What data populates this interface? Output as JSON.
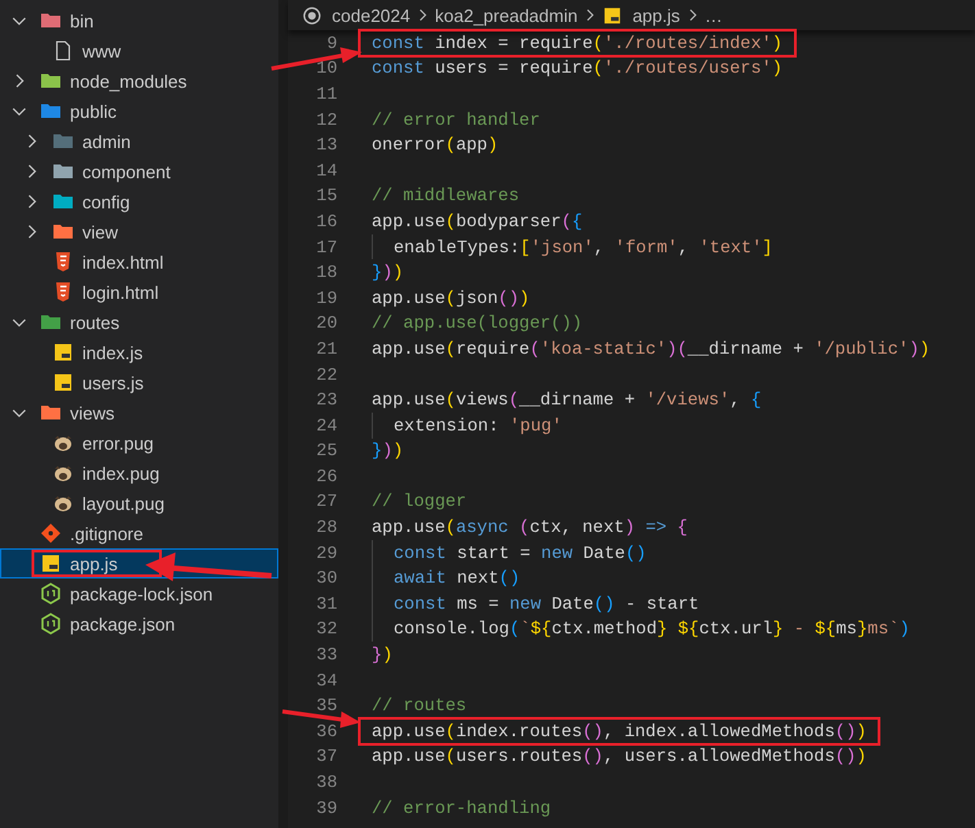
{
  "explorer": {
    "items": [
      {
        "label": "bin",
        "kind": "folder",
        "color": "#e06c75",
        "expanded": true,
        "selected": false,
        "highlighted": false,
        "children": [
          {
            "label": "www",
            "kind": "file",
            "selected": false,
            "highlighted": false
          }
        ]
      },
      {
        "label": "node_modules",
        "kind": "folder",
        "color": "#8bc34a",
        "expanded": false,
        "selected": false,
        "highlighted": false
      },
      {
        "label": "public",
        "kind": "folder",
        "color": "#1e88e5",
        "expanded": true,
        "selected": false,
        "highlighted": false,
        "children": [
          {
            "label": "admin",
            "kind": "folder",
            "color": "#546e7a",
            "expanded": false,
            "selected": false,
            "highlighted": false
          },
          {
            "label": "component",
            "kind": "folder",
            "color": "#90a4ae",
            "expanded": false,
            "selected": false,
            "highlighted": false
          },
          {
            "label": "config",
            "kind": "folder",
            "color": "#00acc1",
            "expanded": false,
            "selected": false,
            "highlighted": false
          },
          {
            "label": "view",
            "kind": "folder",
            "color": "#ff7043",
            "expanded": false,
            "selected": false,
            "highlighted": false
          },
          {
            "label": "index.html",
            "kind": "html",
            "selected": false,
            "highlighted": false
          },
          {
            "label": "login.html",
            "kind": "html",
            "selected": false,
            "highlighted": false
          }
        ]
      },
      {
        "label": "routes",
        "kind": "folder",
        "color": "#43a047",
        "expanded": true,
        "selected": false,
        "highlighted": false,
        "children": [
          {
            "label": "index.js",
            "kind": "js",
            "selected": false,
            "highlighted": false
          },
          {
            "label": "users.js",
            "kind": "js",
            "selected": false,
            "highlighted": false
          }
        ]
      },
      {
        "label": "views",
        "kind": "folder",
        "color": "#ff7043",
        "expanded": true,
        "selected": false,
        "highlighted": false,
        "children": [
          {
            "label": "error.pug",
            "kind": "pug",
            "selected": false,
            "highlighted": false
          },
          {
            "label": "index.pug",
            "kind": "pug",
            "selected": false,
            "highlighted": false
          },
          {
            "label": "layout.pug",
            "kind": "pug",
            "selected": false,
            "highlighted": false
          }
        ]
      },
      {
        "label": ".gitignore",
        "kind": "git",
        "selected": false,
        "highlighted": false
      },
      {
        "label": "app.js",
        "kind": "js",
        "selected": true,
        "highlighted": true
      },
      {
        "label": "package-lock.json",
        "kind": "node",
        "selected": false,
        "highlighted": false
      },
      {
        "label": "package.json",
        "kind": "node",
        "selected": false,
        "highlighted": false
      }
    ]
  },
  "breadcrumb": [
    {
      "label": "code2024",
      "kind": "root"
    },
    {
      "label": "koa2_preadadmin",
      "kind": "folder"
    },
    {
      "label": "app.js",
      "kind": "js"
    },
    {
      "label": "…",
      "kind": "more"
    }
  ],
  "editor": {
    "lines": [
      {
        "number": "9",
        "indented": false,
        "highlighted": true,
        "tokens": [
          {
            "text": "const ",
            "kind": "kw"
          },
          {
            "text": "index = require",
            "kind": "plain"
          },
          {
            "text": "(",
            "kind": "b1"
          },
          {
            "text": "'./routes/index'",
            "kind": "str"
          },
          {
            "text": ")",
            "kind": "b1"
          }
        ]
      },
      {
        "number": "10",
        "indented": false,
        "highlighted": false,
        "tokens": [
          {
            "text": "const ",
            "kind": "kw"
          },
          {
            "text": "users = require",
            "kind": "plain"
          },
          {
            "text": "(",
            "kind": "b1"
          },
          {
            "text": "'./routes/users'",
            "kind": "str"
          },
          {
            "text": ")",
            "kind": "b1"
          }
        ]
      },
      {
        "number": "11",
        "indented": false,
        "highlighted": false
      },
      {
        "number": "12",
        "indented": false,
        "highlighted": false,
        "tokens": [
          {
            "text": "// error handler",
            "kind": "com"
          }
        ]
      },
      {
        "number": "13",
        "indented": false,
        "highlighted": false,
        "tokens": [
          {
            "text": "onerror",
            "kind": "plain"
          },
          {
            "text": "(",
            "kind": "b1"
          },
          {
            "text": "app",
            "kind": "plain"
          },
          {
            "text": ")",
            "kind": "b1"
          }
        ]
      },
      {
        "number": "14",
        "indented": false,
        "highlighted": false
      },
      {
        "number": "15",
        "indented": false,
        "highlighted": false,
        "tokens": [
          {
            "text": "// middlewares",
            "kind": "com"
          }
        ]
      },
      {
        "number": "16",
        "indented": false,
        "highlighted": false,
        "tokens": [
          {
            "text": "app.use",
            "kind": "plain"
          },
          {
            "text": "(",
            "kind": "b1"
          },
          {
            "text": "bodyparser",
            "kind": "plain"
          },
          {
            "text": "(",
            "kind": "b2"
          },
          {
            "text": "{",
            "kind": "b3"
          }
        ]
      },
      {
        "number": "17",
        "indented": true,
        "highlighted": false,
        "tokens": [
          {
            "text": "enableTypes:",
            "kind": "plain"
          },
          {
            "text": "[",
            "kind": "b1"
          },
          {
            "text": "'json'",
            "kind": "str"
          },
          {
            "text": ", ",
            "kind": "plain"
          },
          {
            "text": "'form'",
            "kind": "str"
          },
          {
            "text": ", ",
            "kind": "plain"
          },
          {
            "text": "'text'",
            "kind": "str"
          },
          {
            "text": "]",
            "kind": "b1"
          }
        ]
      },
      {
        "number": "18",
        "indented": false,
        "highlighted": false,
        "tokens": [
          {
            "text": "}",
            "kind": "b3"
          },
          {
            "text": ")",
            "kind": "b2"
          },
          {
            "text": ")",
            "kind": "b1"
          }
        ]
      },
      {
        "number": "19",
        "indented": false,
        "highlighted": false,
        "tokens": [
          {
            "text": "app.use",
            "kind": "plain"
          },
          {
            "text": "(",
            "kind": "b1"
          },
          {
            "text": "json",
            "kind": "plain"
          },
          {
            "text": "()",
            "kind": "b2"
          },
          {
            "text": ")",
            "kind": "b1"
          }
        ]
      },
      {
        "number": "20",
        "indented": false,
        "highlighted": false,
        "tokens": [
          {
            "text": "// app.use(logger())",
            "kind": "com"
          }
        ]
      },
      {
        "number": "21",
        "indented": false,
        "highlighted": false,
        "tokens": [
          {
            "text": "app.use",
            "kind": "plain"
          },
          {
            "text": "(",
            "kind": "b1"
          },
          {
            "text": "require",
            "kind": "plain"
          },
          {
            "text": "(",
            "kind": "b2"
          },
          {
            "text": "'koa-static'",
            "kind": "str"
          },
          {
            "text": ")(",
            "kind": "b2"
          },
          {
            "text": "__dirname + ",
            "kind": "plain"
          },
          {
            "text": "'/public'",
            "kind": "str"
          },
          {
            "text": ")",
            "kind": "b2"
          },
          {
            "text": ")",
            "kind": "b1"
          }
        ]
      },
      {
        "number": "22",
        "indented": false,
        "highlighted": false
      },
      {
        "number": "23",
        "indented": false,
        "highlighted": false,
        "tokens": [
          {
            "text": "app.use",
            "kind": "plain"
          },
          {
            "text": "(",
            "kind": "b1"
          },
          {
            "text": "views",
            "kind": "plain"
          },
          {
            "text": "(",
            "kind": "b2"
          },
          {
            "text": "__dirname + ",
            "kind": "plain"
          },
          {
            "text": "'/views'",
            "kind": "str"
          },
          {
            "text": ", ",
            "kind": "plain"
          },
          {
            "text": "{",
            "kind": "b3"
          }
        ]
      },
      {
        "number": "24",
        "indented": true,
        "highlighted": false,
        "tokens": [
          {
            "text": "extension: ",
            "kind": "plain"
          },
          {
            "text": "'pug'",
            "kind": "str"
          }
        ]
      },
      {
        "number": "25",
        "indented": false,
        "highlighted": false,
        "tokens": [
          {
            "text": "}",
            "kind": "b3"
          },
          {
            "text": ")",
            "kind": "b2"
          },
          {
            "text": ")",
            "kind": "b1"
          }
        ]
      },
      {
        "number": "26",
        "indented": false,
        "highlighted": false
      },
      {
        "number": "27",
        "indented": false,
        "highlighted": false,
        "tokens": [
          {
            "text": "// logger",
            "kind": "com"
          }
        ]
      },
      {
        "number": "28",
        "indented": false,
        "highlighted": false,
        "tokens": [
          {
            "text": "app.use",
            "kind": "plain"
          },
          {
            "text": "(",
            "kind": "b1"
          },
          {
            "text": "async ",
            "kind": "kw"
          },
          {
            "text": "(",
            "kind": "b2"
          },
          {
            "text": "ctx, next",
            "kind": "plain"
          },
          {
            "text": ")",
            "kind": "b2"
          },
          {
            "text": " => ",
            "kind": "kw"
          },
          {
            "text": "{",
            "kind": "b2"
          }
        ]
      },
      {
        "number": "29",
        "indented": true,
        "highlighted": false,
        "tokens": [
          {
            "text": "const ",
            "kind": "kw"
          },
          {
            "text": "start = ",
            "kind": "plain"
          },
          {
            "text": "new ",
            "kind": "kw"
          },
          {
            "text": "Date",
            "kind": "plain"
          },
          {
            "text": "()",
            "kind": "b3"
          }
        ]
      },
      {
        "number": "30",
        "indented": true,
        "highlighted": false,
        "tokens": [
          {
            "text": "await ",
            "kind": "kw"
          },
          {
            "text": "next",
            "kind": "plain"
          },
          {
            "text": "()",
            "kind": "b3"
          }
        ]
      },
      {
        "number": "31",
        "indented": true,
        "highlighted": false,
        "tokens": [
          {
            "text": "const ",
            "kind": "kw"
          },
          {
            "text": "ms = ",
            "kind": "plain"
          },
          {
            "text": "new ",
            "kind": "kw"
          },
          {
            "text": "Date",
            "kind": "plain"
          },
          {
            "text": "()",
            "kind": "b3"
          },
          {
            "text": " - start",
            "kind": "plain"
          }
        ]
      },
      {
        "number": "32",
        "indented": true,
        "highlighted": false,
        "tokens": [
          {
            "text": "console.log",
            "kind": "plain"
          },
          {
            "text": "(",
            "kind": "b3"
          },
          {
            "text": "`",
            "kind": "str"
          },
          {
            "text": "${",
            "kind": "b1"
          },
          {
            "text": "ctx.method",
            "kind": "plain"
          },
          {
            "text": "} ",
            "kind": "b1"
          },
          {
            "text": "${",
            "kind": "b1"
          },
          {
            "text": "ctx.url",
            "kind": "plain"
          },
          {
            "text": "}",
            "kind": "b1"
          },
          {
            "text": " - ",
            "kind": "str"
          },
          {
            "text": "${",
            "kind": "b1"
          },
          {
            "text": "ms",
            "kind": "plain"
          },
          {
            "text": "}",
            "kind": "b1"
          },
          {
            "text": "ms`",
            "kind": "str"
          },
          {
            "text": ")",
            "kind": "b3"
          }
        ]
      },
      {
        "number": "33",
        "indented": false,
        "highlighted": false,
        "tokens": [
          {
            "text": "}",
            "kind": "b2"
          },
          {
            "text": ")",
            "kind": "b1"
          }
        ]
      },
      {
        "number": "34",
        "indented": false,
        "highlighted": false
      },
      {
        "number": "35",
        "indented": false,
        "highlighted": false,
        "tokens": [
          {
            "text": "// routes",
            "kind": "com"
          }
        ]
      },
      {
        "number": "36",
        "indented": false,
        "highlighted": true,
        "tokens": [
          {
            "text": "app.use",
            "kind": "plain"
          },
          {
            "text": "(",
            "kind": "b1"
          },
          {
            "text": "index.routes",
            "kind": "plain"
          },
          {
            "text": "()",
            "kind": "b2"
          },
          {
            "text": ", index.allowedMethods",
            "kind": "plain"
          },
          {
            "text": "()",
            "kind": "b2"
          },
          {
            "text": ")",
            "kind": "b1"
          }
        ]
      },
      {
        "number": "37",
        "indented": false,
        "highlighted": false,
        "tokens": [
          {
            "text": "app.use",
            "kind": "plain"
          },
          {
            "text": "(",
            "kind": "b1"
          },
          {
            "text": "users.routes",
            "kind": "plain"
          },
          {
            "text": "()",
            "kind": "b2"
          },
          {
            "text": ", users.allowedMethods",
            "kind": "plain"
          },
          {
            "text": "()",
            "kind": "b2"
          },
          {
            "text": ")",
            "kind": "b1"
          }
        ]
      },
      {
        "number": "38",
        "indented": false,
        "highlighted": false
      },
      {
        "number": "39",
        "indented": false,
        "highlighted": false,
        "tokens": [
          {
            "text": "// error-handling",
            "kind": "com"
          }
        ]
      }
    ]
  }
}
